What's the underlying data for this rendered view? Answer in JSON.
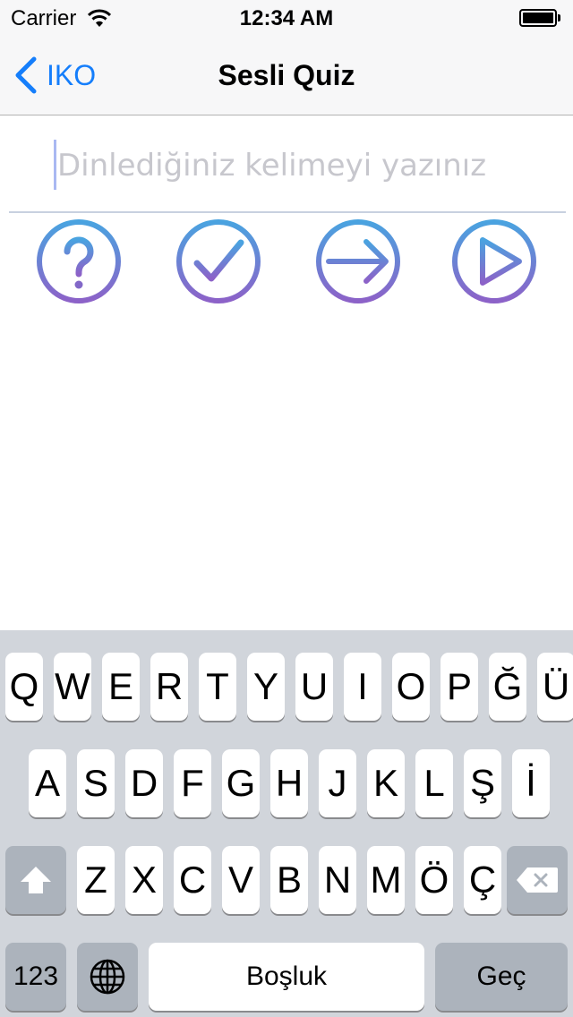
{
  "status_bar": {
    "carrier": "Carrier",
    "time": "12:34 AM"
  },
  "nav": {
    "back_label": "IKO",
    "title": "Sesli Quiz"
  },
  "answer": {
    "placeholder": "Dinlediğiniz kelimeyi yazınız",
    "value": ""
  },
  "actions": [
    {
      "id": "hint",
      "icon": "question-mark-icon"
    },
    {
      "id": "check",
      "icon": "checkmark-icon"
    },
    {
      "id": "next",
      "icon": "arrow-right-icon"
    },
    {
      "id": "play",
      "icon": "play-icon"
    }
  ],
  "keyboard": {
    "row1": [
      "Q",
      "W",
      "E",
      "R",
      "T",
      "Y",
      "U",
      "I",
      "O",
      "P",
      "Ğ",
      "Ü"
    ],
    "row2": [
      "A",
      "S",
      "D",
      "F",
      "G",
      "H",
      "J",
      "K",
      "L",
      "Ş",
      "İ"
    ],
    "row3": [
      "Z",
      "X",
      "C",
      "V",
      "B",
      "N",
      "M",
      "Ö",
      "Ç"
    ],
    "numbers_label": "123",
    "space_label": "Boşluk",
    "return_label": "Geç"
  },
  "colors": {
    "accent": "#157efb",
    "icon_gradient_top": "#4aa3e0",
    "icon_gradient_bottom": "#8c62c8"
  }
}
